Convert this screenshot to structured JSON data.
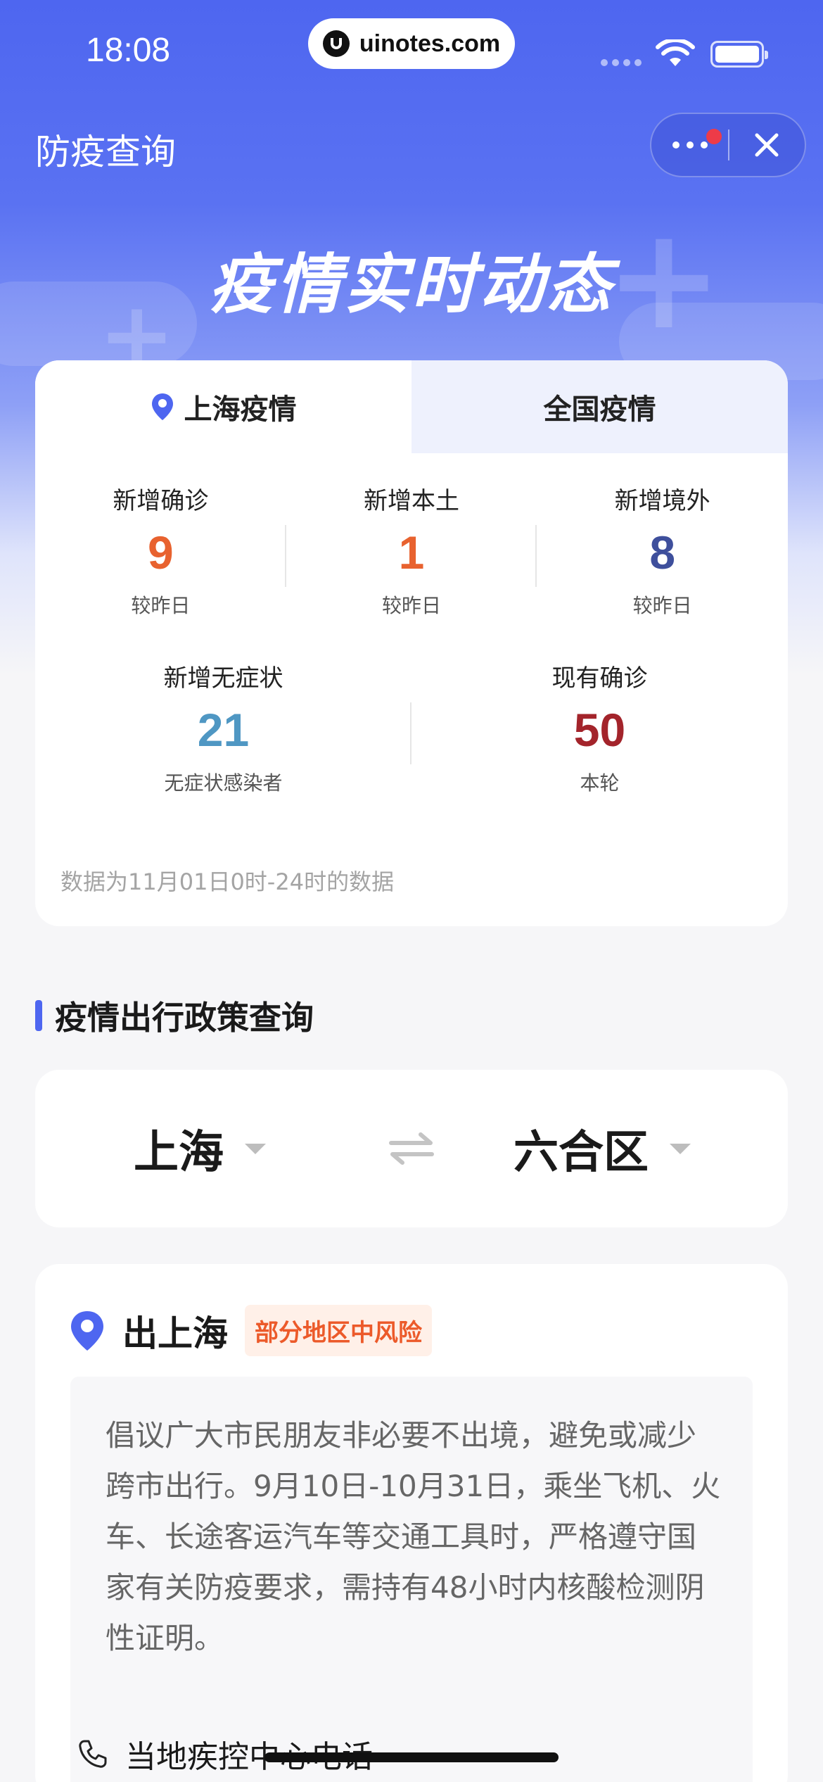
{
  "status_bar": {
    "time": "18:08",
    "url": "uinotes.com"
  },
  "header": {
    "title": "防疫查询",
    "hero_title": "疫情实时动态"
  },
  "stats": {
    "tabs": [
      {
        "label": "上海疫情",
        "active": true
      },
      {
        "label": "全国疫情",
        "active": false
      }
    ],
    "row1": [
      {
        "label": "新增确诊",
        "value": "9",
        "sub": "较昨日",
        "color": "#e8622f"
      },
      {
        "label": "新增本土",
        "value": "1",
        "sub": "较昨日",
        "color": "#e8622f"
      },
      {
        "label": "新增境外",
        "value": "8",
        "sub": "较昨日",
        "color": "#3e4f9c"
      }
    ],
    "row2": [
      {
        "label": "新增无症状",
        "value": "21",
        "sub": "无症状感染者",
        "color": "#4f97c3"
      },
      {
        "label": "现有确诊",
        "value": "50",
        "sub": "本轮",
        "color": "#a3242b"
      }
    ],
    "note": "数据为11月01日0时-24时的数据"
  },
  "policy_query": {
    "section_title": "疫情出行政策查询",
    "from": "上海",
    "to": "六合区"
  },
  "policy": {
    "title": "出上海",
    "risk_badge": "部分地区中风险",
    "text": "倡议广大市民朋友非必要不出境，避免或减少跨市出行。9月10日-10月31日，乘坐飞机、火车、长途客运汽车等交通工具时，严格遵守国家有关防疫要求，需持有48小时内核酸检测阴性证明。",
    "phone_label": "当地疾控中心电话"
  },
  "colors": {
    "accent": "#4e66f0",
    "risk": "#ec5a2a"
  }
}
